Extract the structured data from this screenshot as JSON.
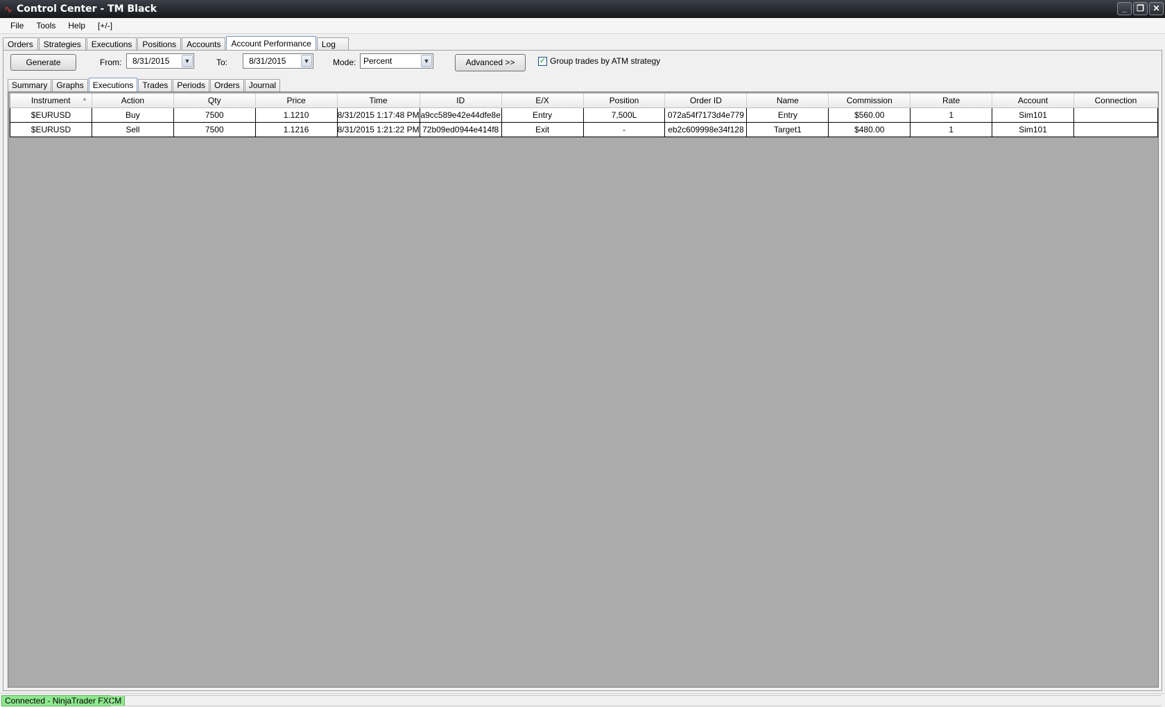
{
  "window": {
    "title": "Control Center - TM Black",
    "icon": "ninjatrader-logo-icon"
  },
  "window_controls": {
    "minimize": "_",
    "restore": "❐",
    "close": "✕"
  },
  "menu": [
    "File",
    "Tools",
    "Help",
    "[+/-]"
  ],
  "top_tabs": [
    "Orders",
    "Strategies",
    "Executions",
    "Positions",
    "Accounts",
    "Account Performance",
    "Log"
  ],
  "top_tabs_active": "Account Performance",
  "controls": {
    "generate_label": "Generate",
    "from_label": "From:",
    "from_value": "8/31/2015",
    "to_label": "To:",
    "to_value": "8/31/2015",
    "mode_label": "Mode:",
    "mode_value": "Percent",
    "advanced_label": "Advanced >>",
    "group_trades_label": "Group trades by ATM strategy",
    "group_trades_checked": true
  },
  "sub_tabs": [
    "Summary",
    "Graphs",
    "Executions",
    "Trades",
    "Periods",
    "Orders",
    "Journal"
  ],
  "sub_tabs_active": "Executions",
  "grid": {
    "columns": [
      "Instrument",
      "Action",
      "Qty",
      "Price",
      "Time",
      "ID",
      "E/X",
      "Position",
      "Order ID",
      "Name",
      "Commission",
      "Rate",
      "Account",
      "Connection"
    ],
    "sorted_column": "Instrument",
    "rows": [
      [
        "$EURUSD",
        "Buy",
        "7500",
        "1.1210",
        "8/31/2015 1:17:48 PM",
        "a9cc589e42e44dfe8e",
        "Entry",
        "7,500L",
        "072a54f7173d4e779",
        "Entry",
        "$560.00",
        "1",
        "Sim101",
        ""
      ],
      [
        "$EURUSD",
        "Sell",
        "7500",
        "1.1216",
        "8/31/2015 1:21:22 PM",
        "72b09ed0944e414f8",
        "Exit",
        "-",
        "eb2c609998e34f128",
        "Target1",
        "$480.00",
        "1",
        "Sim101",
        ""
      ]
    ]
  },
  "status": {
    "connection": "Connected - NinjaTrader FXCM",
    "connection_color": "#8fe88f"
  }
}
